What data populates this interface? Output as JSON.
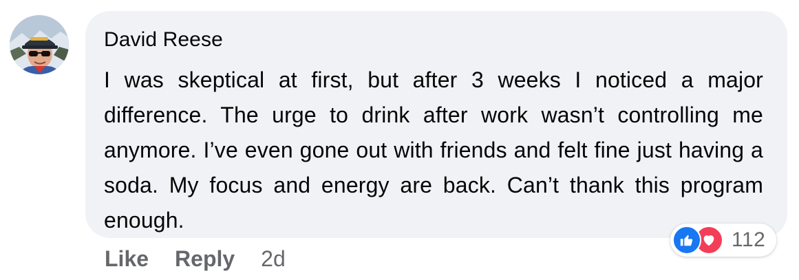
{
  "comment": {
    "author": "David Reese",
    "text": "I was skeptical at first, but after 3 weeks I noticed a major difference. The urge to drink after work wasn’t controlling me anymore. I’ve even gone out with friends and felt fine just having a soda. My focus and energy are back. Can’t thank this program enough.",
    "avatar_icon": "profile-photo"
  },
  "reactions": {
    "icons": [
      "like-icon",
      "love-icon"
    ],
    "count": "112",
    "like_color": "#1877f2",
    "love_color": "#f33e58"
  },
  "actions": {
    "like_label": "Like",
    "reply_label": "Reply",
    "timestamp": "2d"
  },
  "colors": {
    "bubble_bg": "#f0f2f5",
    "text": "#050505",
    "secondary_text": "#65676b"
  }
}
